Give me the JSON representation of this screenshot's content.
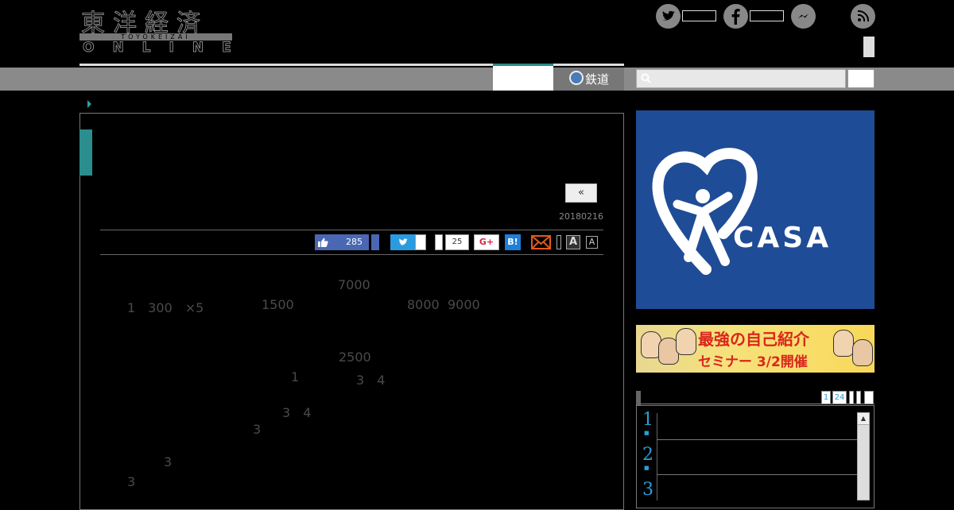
{
  "header": {
    "logo_kanji": "東洋経済",
    "logo_romaji": "TOYOKEIZAI",
    "logo_online": "ONLINE",
    "social": {
      "twitter_icon": "twitter-icon",
      "facebook_icon": "facebook-icon",
      "messenger_icon": "messenger-icon",
      "rss_icon": "rss-icon"
    }
  },
  "nav": {
    "rail_label": "鉄道",
    "search_placeholder": ""
  },
  "article": {
    "prev_label": "«",
    "date": "20180216",
    "share": {
      "like_count": "285",
      "tweet_label": "t",
      "gplus_count": "25",
      "gplus_label": "G+",
      "hatena_label": "B!",
      "font_large": "A",
      "font_small": "A"
    },
    "paragraphs": [
      "7000  1300×5 1500 80009000 ",
      "2500 1 34",
      "34 3",
      "3 3"
    ],
    "paragraph_fragments": {
      "p1": [
        "7000",
        "1",
        "300",
        "×5",
        "1500",
        "8000",
        "9000"
      ],
      "p2": [
        "2500",
        "1",
        "3",
        "4"
      ],
      "p3": [
        "3",
        "4",
        "3"
      ],
      "p4": [
        "3",
        "3"
      ]
    }
  },
  "sidebar": {
    "ad_casa_text": "CASA",
    "ad_casa_reg": "®",
    "ad_seminar_line1": "最強の自己紹介",
    "ad_seminar_line2": "セミナー 3/2開催",
    "ranking": {
      "page_current": "1",
      "page_total": "24",
      "numbers": [
        "1",
        "2",
        "3"
      ]
    }
  },
  "colors": {
    "accent_teal": "#2a8e8e",
    "nav_gray": "#8a8a8a",
    "casa_blue": "#1f4c96",
    "rank_blue": "#2a9ed6",
    "like_blue": "#4a67b3",
    "twitter_blue": "#2b9be0"
  }
}
